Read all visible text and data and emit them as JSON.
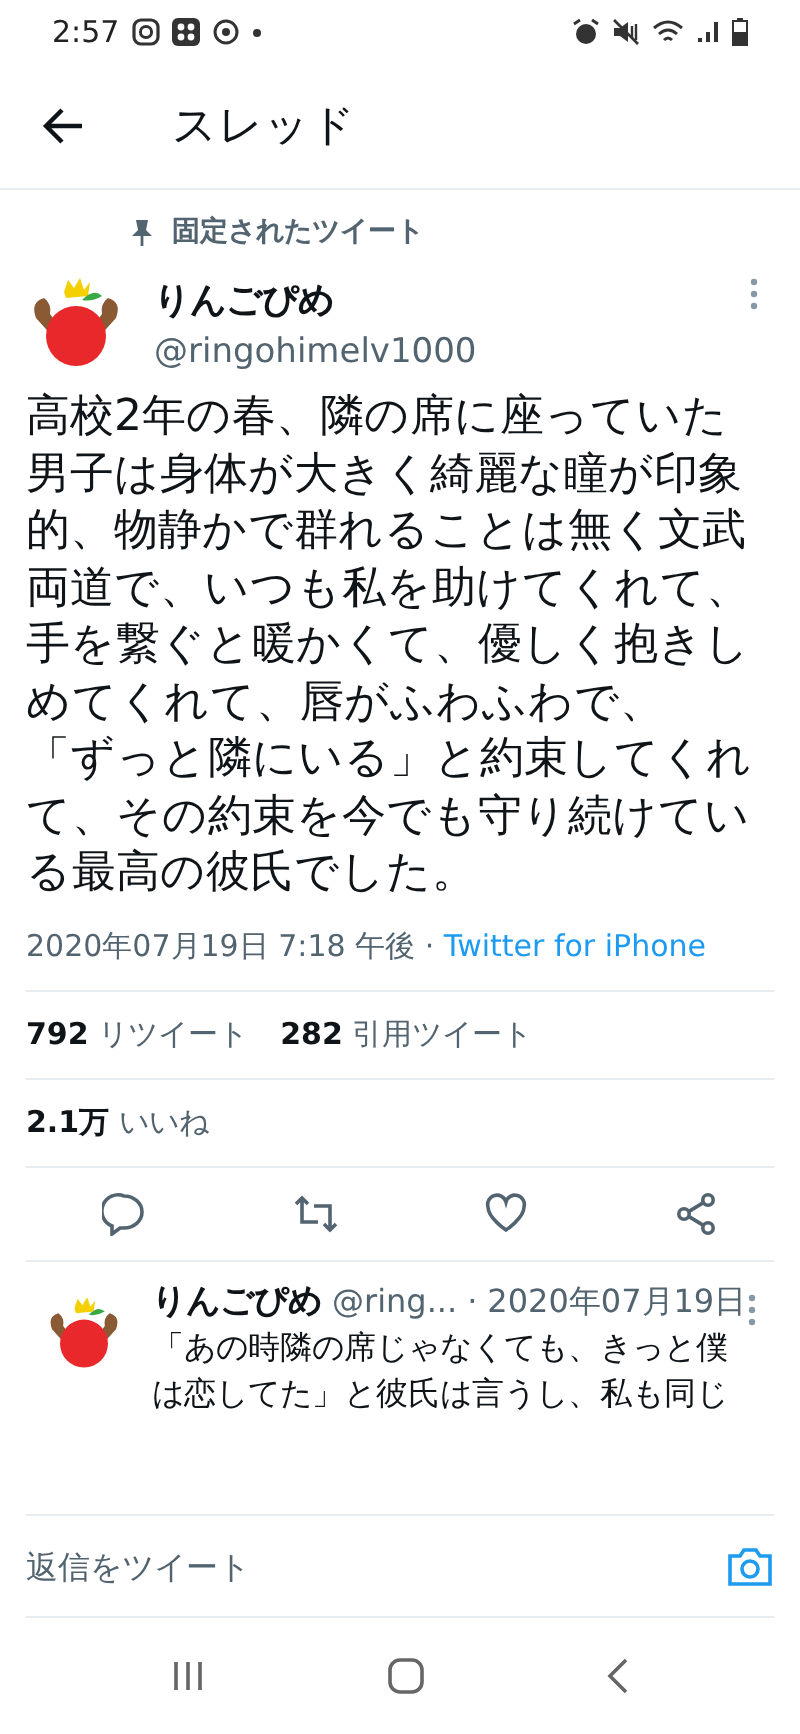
{
  "status_bar": {
    "time": "2:57"
  },
  "header": {
    "title": "スレッド"
  },
  "tweet": {
    "pinned_label": "固定されたツイート",
    "name": "りんごぴめ",
    "handle": "@ringohimelv1000",
    "paragraphs": [
      "高校2年の春、隣の席に座っていた男子は身体が大きく綺麗な瞳が印象的、物静かで群れることは無く文武両道で、いつも私を助けてくれて、手を繋ぐと暖かくて、優しく抱きしめてくれて、唇がふわふわで、",
      "「ずっと隣にいる」と約束してくれて、その約束を今でも守り続けている最高の彼氏でした。"
    ],
    "timestamp": "2020年07月19日 7:18 午後",
    "separator": "·",
    "source": "Twitter for iPhone",
    "stats_rows": [
      [
        {
          "count": "792",
          "label": "リツイート"
        },
        {
          "count": "282",
          "label": "引用ツイート"
        }
      ],
      [
        {
          "count": "2.1万",
          "label": "いいね"
        }
      ]
    ]
  },
  "reply": {
    "name": "りんごぴめ",
    "handle": "@ring...",
    "separator": "·",
    "date": "2020年07月19日",
    "text": "「あの時隣の席じゃなくても、きっと僕は恋してた」と彼氏は言うし、私も同じ"
  },
  "compose": {
    "placeholder": "返信をツイート"
  }
}
